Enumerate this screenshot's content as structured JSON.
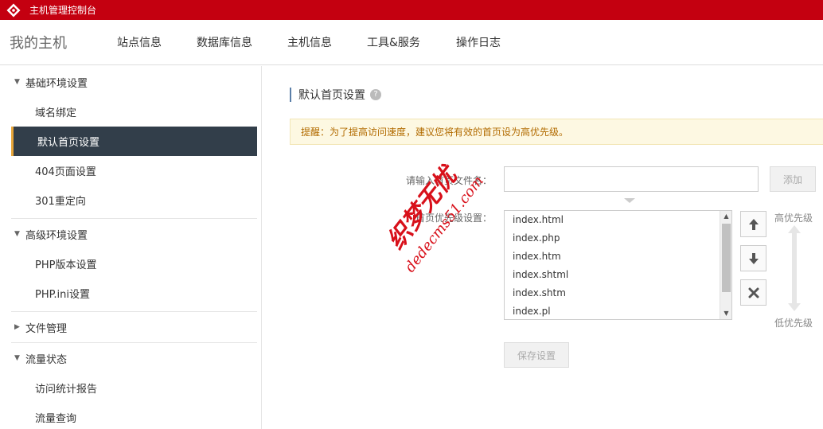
{
  "topbar": {
    "title": "主机管理控制台",
    "logo_icon": "brand-logo"
  },
  "nav": {
    "brand": "我的主机",
    "items": [
      {
        "label": "站点信息"
      },
      {
        "label": "数据库信息"
      },
      {
        "label": "主机信息"
      },
      {
        "label": "工具&服务"
      },
      {
        "label": "操作日志"
      }
    ]
  },
  "sidebar": {
    "groups": [
      {
        "label": "基础环境设置",
        "expanded": true,
        "items": [
          {
            "label": "域名绑定"
          },
          {
            "label": "默认首页设置",
            "active": true
          },
          {
            "label": "404页面设置"
          },
          {
            "label": "301重定向"
          }
        ]
      },
      {
        "label": "高级环境设置",
        "expanded": true,
        "items": [
          {
            "label": "PHP版本设置"
          },
          {
            "label": "PHP.ini设置"
          }
        ]
      },
      {
        "label": "文件管理",
        "expanded": false,
        "items": []
      },
      {
        "label": "流量状态",
        "expanded": true,
        "items": [
          {
            "label": "访问统计报告"
          },
          {
            "label": "流量查询"
          }
        ]
      }
    ]
  },
  "main": {
    "title": "默认首页设置",
    "help_icon": "?",
    "notice": "提醒：为了提高访问速度，建议您将有效的首页设为高优先级。",
    "input_label": "请输入首页文件名：",
    "input_value": "",
    "add_button": "添加",
    "priority_label": "首页优先级设置：",
    "files": [
      "index.html",
      "index.php",
      "index.htm",
      "index.shtml",
      "index.shtm",
      "index.pl"
    ],
    "move_up_icon": "arrow-up-icon",
    "move_down_icon": "arrow-down-icon",
    "remove_icon": "close-icon",
    "high_priority": "高优先级",
    "low_priority": "低优先级",
    "save_button": "保存设置"
  },
  "watermark": {
    "line1": "织梦无忧",
    "line2": "dedecms51.com"
  },
  "colors": {
    "topbar": "#c40010",
    "active_bg": "#323e4a",
    "active_accent": "#e8a63a",
    "notice_bg": "#fdf8e2",
    "notice_text": "#b26b00"
  }
}
